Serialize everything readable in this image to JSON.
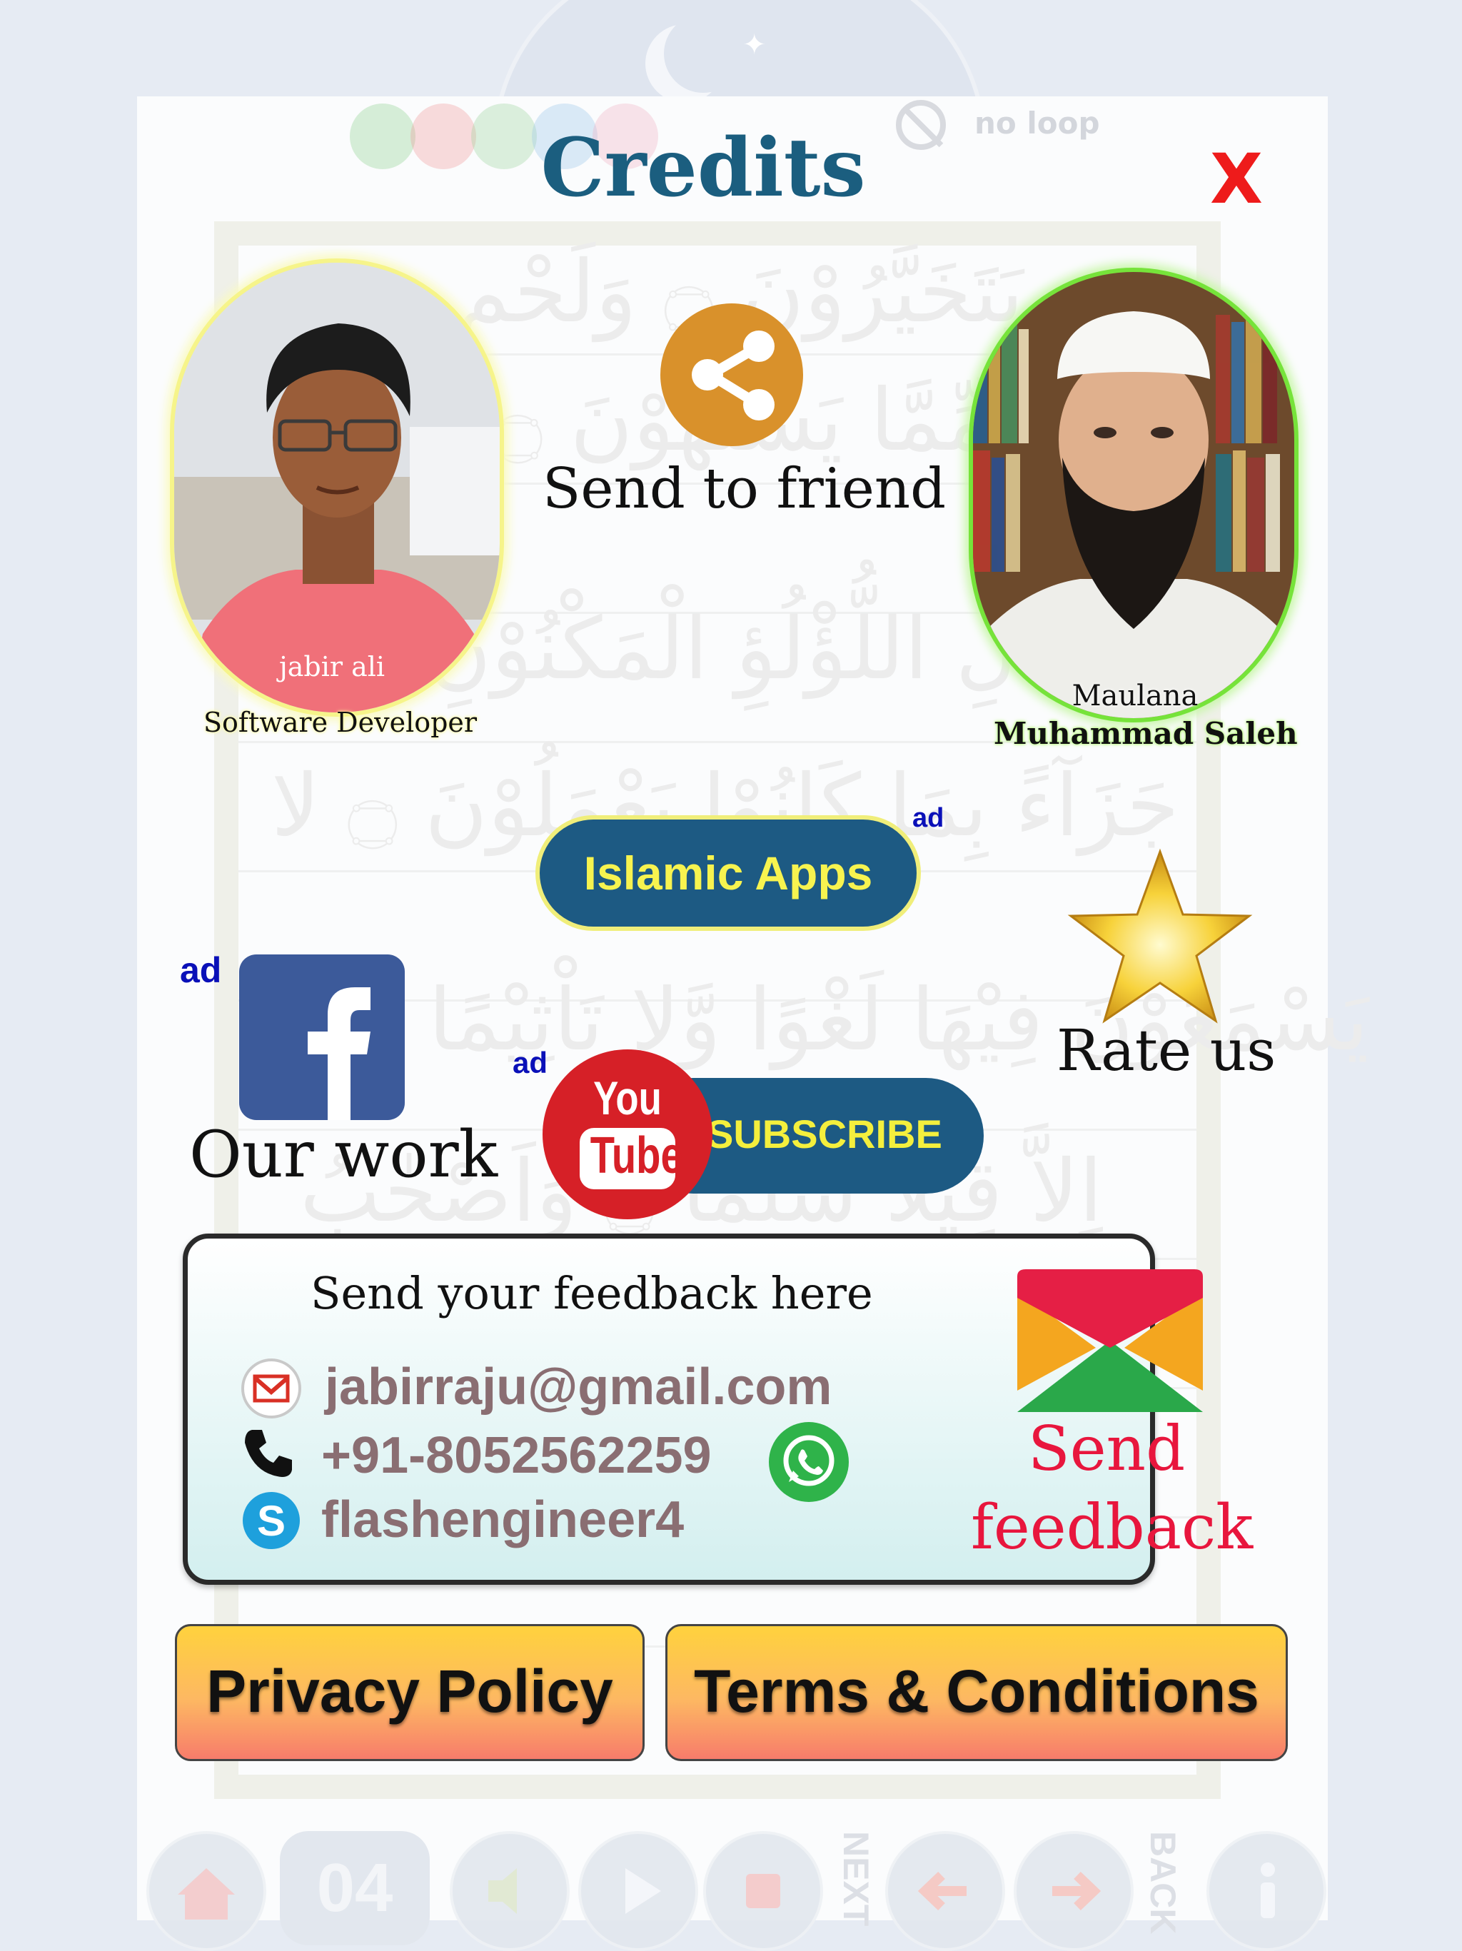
{
  "background": {
    "top_bar": {
      "loop_label": "no loop"
    },
    "nav": {
      "page_number": "04",
      "next_label": "NEXT",
      "back_label": "BACK"
    }
  },
  "dialog": {
    "title": "Credits",
    "close_label": "X",
    "developer": {
      "name": "jabir ali",
      "role": "Software Developer"
    },
    "scholar": {
      "title_line": "Maulana",
      "name": "Muhammad Saleh"
    },
    "share": {
      "label": "Send to friend",
      "icon": "share-icon"
    },
    "islamic_apps": {
      "label": "Islamic Apps",
      "ad_tag": "ad"
    },
    "rate": {
      "label": "Rate us",
      "icon": "star-icon"
    },
    "facebook": {
      "label": "Our work",
      "ad_tag": "ad",
      "icon": "facebook-icon"
    },
    "youtube": {
      "logo_top": "You",
      "logo_bottom": "Tube",
      "button_label": "SUBSCRIBE",
      "ad_tag": "ad"
    },
    "feedback": {
      "heading": "Send your feedback here",
      "email": "jabirraju@gmail.com",
      "phone": "+91-8052562259",
      "skype": "flashengineer4",
      "send_line1": "Send",
      "send_line2": "feedback"
    },
    "privacy_label": "Privacy Policy",
    "terms_label": "Terms & Conditions"
  },
  "colors": {
    "title": "#1b5e7f",
    "close": "#ee1b1b",
    "pill": "#1d5a83",
    "pill_text": "#f7f34f",
    "share": "#d9912b",
    "send_feedback": "#e8163d"
  }
}
